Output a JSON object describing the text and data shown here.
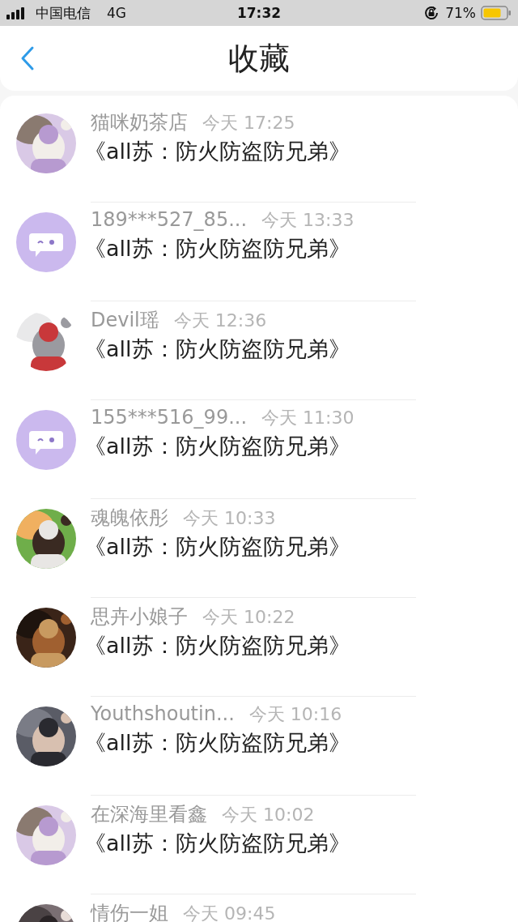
{
  "status_bar": {
    "carrier": "中国电信",
    "network": "4G",
    "time": "17:32",
    "battery": "71%"
  },
  "header": {
    "title": "收藏"
  },
  "items": [
    {
      "name": "猫咪奶茶店",
      "time": "今天 17:25",
      "title": "《all苏：防火防盗防兄弟》"
    },
    {
      "avatar": {
        "kind": "default"
      },
      "name": "189***527_85...",
      "time": "今天 13:33",
      "title": "《all苏：防火防盗防兄弟》"
    },
    {
      "name": "Devil瑶",
      "time": "今天 12:36",
      "title": "《all苏：防火防盗防兄弟》"
    },
    {
      "avatar": {
        "kind": "default"
      },
      "name": "155***516_99...",
      "time": "今天 11:30",
      "title": "《all苏：防火防盗防兄弟》"
    },
    {
      "name": "魂魄依彤",
      "time": "今天 10:33",
      "title": "《all苏：防火防盗防兄弟》"
    },
    {
      "name": "思卉小娘子",
      "time": "今天 10:22",
      "title": "《all苏：防火防盗防兄弟》"
    },
    {
      "name": "Youthshoutin...",
      "time": "今天 10:16",
      "title": "《all苏：防火防盗防兄弟》"
    },
    {
      "name": "在深海里看鑫",
      "time": "今天 10:02",
      "title": "《all苏：防火防盗防兄弟》"
    },
    {
      "name": "情伤一姐",
      "time": "今天 09:45"
    }
  ]
}
